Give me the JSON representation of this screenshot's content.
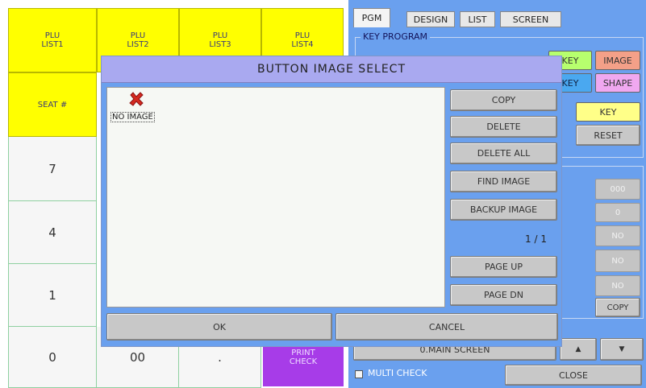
{
  "keypad": {
    "plu": [
      "PLU\nLIST1",
      "PLU\nLIST2",
      "PLU\nLIST3",
      "PLU\nLIST4"
    ],
    "seat": "SEAT #",
    "n7": "7",
    "n4": "4",
    "n1": "1",
    "n0": "0",
    "n00": "00",
    "dot": ".",
    "print_check": "PRINT\nCHECK"
  },
  "right_panel": {
    "tabs": [
      "PGM",
      "DESIGN",
      "LIST",
      "SCREEN"
    ],
    "group_title": "KEY PROGRAM",
    "key_btn_1": "KEY",
    "image_btn": "IMAGE",
    "key_btn_2": "KEY",
    "shape_btn": "SHAPE",
    "key_btn_3": "KEY",
    "reset_btn": "RESET",
    "disabled_values": [
      "000",
      "0",
      "NO",
      "NO",
      "NO"
    ],
    "copy_btn": "COPY",
    "main_screen_btn": "0.MAIN SCREEN",
    "up_arrow": "▲",
    "down_arrow": "▼",
    "multi_check_label": "MULTI CHECK",
    "close_btn": "CLOSE"
  },
  "dialog": {
    "title": "BUTTON IMAGE SELECT",
    "item_label": "NO IMAGE",
    "buttons": {
      "copy": "COPY",
      "delete": "DELETE",
      "delete_all": "DELETE ALL",
      "find_image": "FIND IMAGE",
      "backup_image": "BACKUP IMAGE",
      "page_up": "PAGE UP",
      "page_dn": "PAGE DN",
      "ok": "OK",
      "cancel": "CANCEL"
    },
    "page_indicator": "1 / 1"
  },
  "colors": {
    "yellow": "#ffff00",
    "dialog_title_bg": "#a9a9f0",
    "dialog_bg": "#6aa0ee",
    "purple": "#a73ce8"
  }
}
